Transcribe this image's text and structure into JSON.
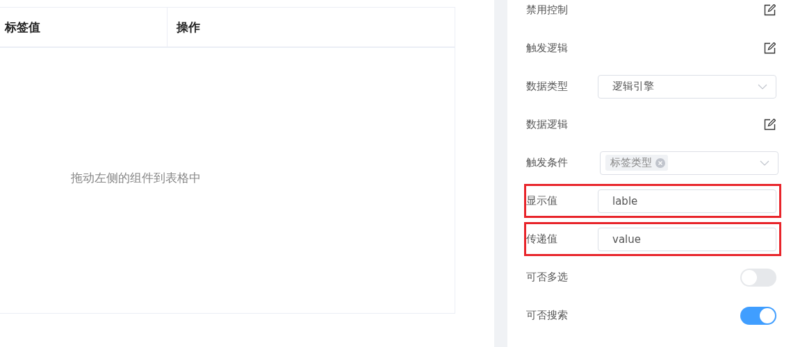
{
  "table": {
    "columns": [
      "标签值",
      "操作"
    ],
    "empty_text": "拖动左侧的组件到表格中"
  },
  "properties": [
    {
      "kind": "edit",
      "label": "禁用控制",
      "highlighted": false
    },
    {
      "kind": "edit",
      "label": "触发逻辑",
      "highlighted": false
    },
    {
      "kind": "select",
      "label": "数据类型",
      "value": "逻辑引擎",
      "highlighted": false
    },
    {
      "kind": "edit",
      "label": "数据逻辑",
      "highlighted": false
    },
    {
      "kind": "tags",
      "label": "触发条件",
      "tags": [
        "标签类型"
      ],
      "highlighted": false
    },
    {
      "kind": "input",
      "label": "显示值",
      "value": "lable",
      "highlighted": true
    },
    {
      "kind": "input",
      "label": "传递值",
      "value": "value",
      "highlighted": true
    },
    {
      "kind": "switch",
      "label": "可否多选",
      "on": false,
      "highlighted": false
    },
    {
      "kind": "switch",
      "label": "可否搜索",
      "on": true,
      "highlighted": false
    }
  ]
}
